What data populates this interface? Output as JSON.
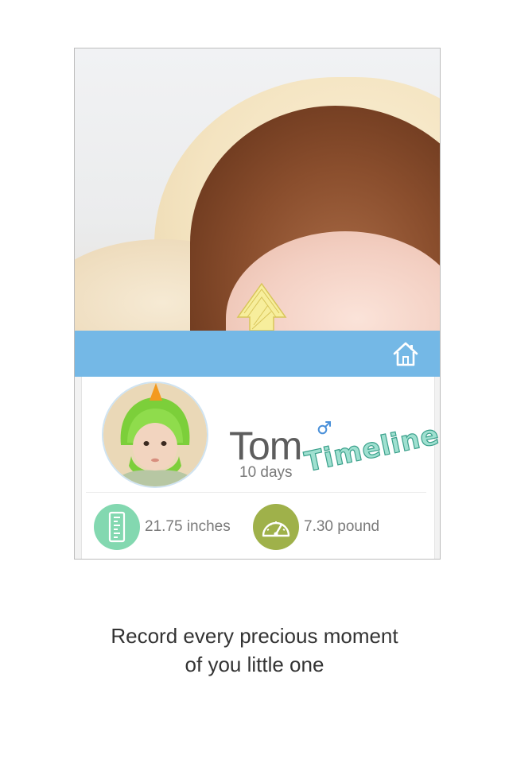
{
  "profile": {
    "name": "Tom",
    "age": "10 days",
    "gender_icon": "male-symbol-icon"
  },
  "timeline_label": "Timeline",
  "stats": {
    "height_value": "21.75 inches",
    "height_icon": "ruler-icon",
    "weight_value": "7.30 pound",
    "weight_icon": "scale-gauge-icon"
  },
  "header": {
    "home_icon": "home-icon"
  },
  "caption": {
    "line1": "Record every precious moment",
    "line2": "of you little one"
  },
  "colors": {
    "header_blue": "#74b8e6",
    "height_badge": "#83d8b0",
    "weight_badge": "#9fb14a",
    "timeline_fill": "#9fe0d0",
    "timeline_stroke": "#3aa08b",
    "male_icon": "#4a90d9",
    "arrow_yellow": "#f5e98a"
  }
}
